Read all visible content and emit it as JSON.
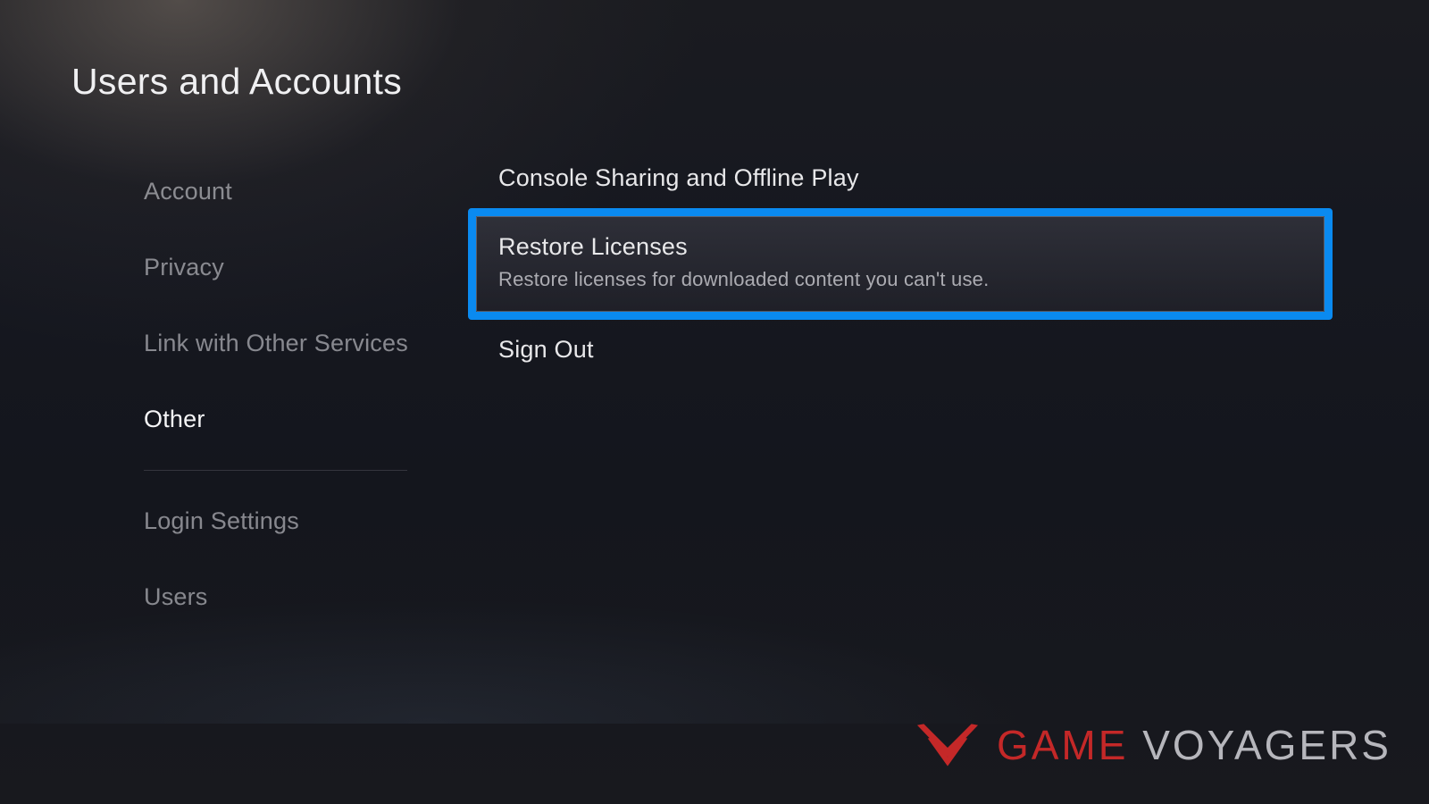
{
  "page_title": "Users and Accounts",
  "sidebar": {
    "items": [
      {
        "label": "Account",
        "active": false
      },
      {
        "label": "Privacy",
        "active": false
      },
      {
        "label": "Link with Other Services",
        "active": false
      },
      {
        "label": "Other",
        "active": true
      },
      {
        "label": "Login Settings",
        "active": false
      },
      {
        "label": "Users",
        "active": false
      }
    ]
  },
  "content": {
    "items": [
      {
        "title": "Console Sharing and Offline Play",
        "description": "",
        "selected": false
      },
      {
        "title": "Restore Licenses",
        "description": "Restore licenses for downloaded content you can't use.",
        "selected": true
      },
      {
        "title": "Sign Out",
        "description": "",
        "selected": false
      }
    ]
  },
  "watermark": {
    "red_text": "GAME",
    "plain_text": " VOYAGERS"
  },
  "colors": {
    "focus": "#0a8af0",
    "brand_red": "#c42828"
  }
}
